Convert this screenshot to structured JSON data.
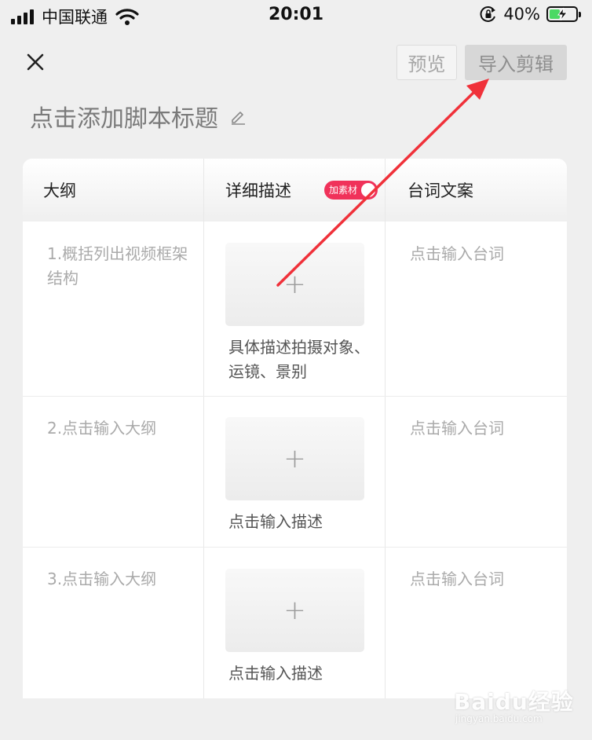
{
  "status_bar": {
    "carrier": "中国联通",
    "time": "20:01",
    "battery_percent": "40%",
    "battery_level": 0.4,
    "icons": [
      "signal-icon",
      "wifi-icon",
      "orientation-lock-icon",
      "battery-charging-icon"
    ]
  },
  "toolbar": {
    "close_icon": "close-icon",
    "preview_label": "预览",
    "import_label": "导入剪辑"
  },
  "script": {
    "title_placeholder": "点击添加脚本标题",
    "edit_icon": "pencil-icon"
  },
  "table": {
    "headers": {
      "outline": "大纲",
      "detail": "详细描述",
      "lines": "台词文案"
    },
    "material_toggle": {
      "label": "加素材",
      "on": true,
      "color": "#f0325a"
    },
    "rows": [
      {
        "outline": "1.概括列出视频框架结构",
        "add_icon": "+",
        "description": "具体描述拍摄对象、运镜、景别",
        "lines": "点击输入台词"
      },
      {
        "outline": "2.点击输入大纲",
        "add_icon": "+",
        "description": "点击输入描述",
        "lines": "点击输入台词"
      },
      {
        "outline": "3.点击输入大纲",
        "add_icon": "+",
        "description": "点击输入描述",
        "lines": "点击输入台词"
      }
    ]
  },
  "annotation": {
    "arrow_color": "#f0313a"
  },
  "watermark": {
    "logo": "Baidu经验",
    "url": "jingyan.baidu.com"
  }
}
